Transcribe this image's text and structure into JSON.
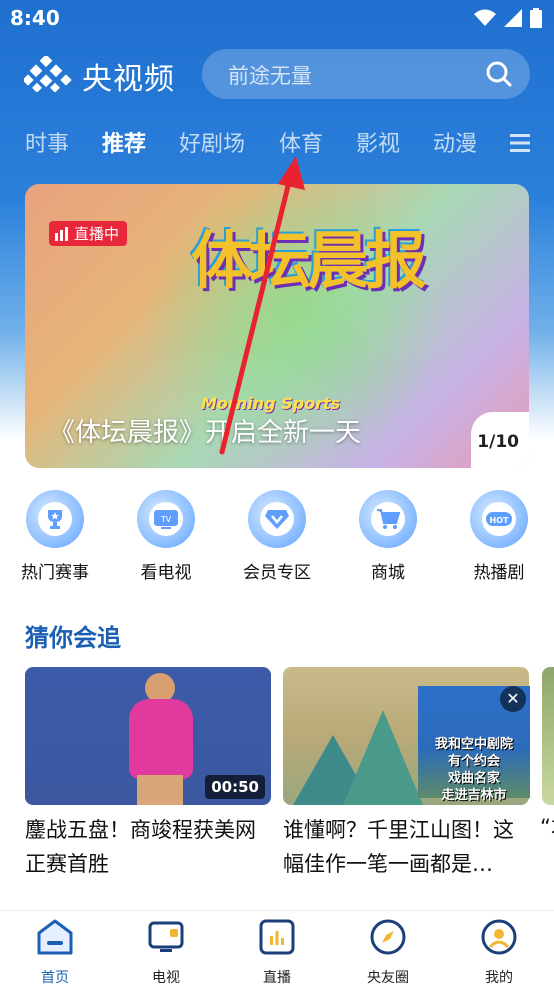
{
  "status_bar": {
    "time": "8:40"
  },
  "header": {
    "app_name": "央视频",
    "search_placeholder": "前途无量"
  },
  "tabs": [
    {
      "label": "时事"
    },
    {
      "label": "推荐"
    },
    {
      "label": "好剧场"
    },
    {
      "label": "体育"
    },
    {
      "label": "影视"
    },
    {
      "label": "动漫"
    }
  ],
  "banner": {
    "live_badge": "直播中",
    "show_logo_text": "体坛晨报",
    "show_logo_subtitle": "Morning Sports",
    "caption": "《体坛晨报》开启全新一天",
    "pager": "1/10"
  },
  "shortcuts": [
    {
      "label": "热门赛事"
    },
    {
      "label": "看电视",
      "badge": "TV"
    },
    {
      "label": "会员专区"
    },
    {
      "label": "商城"
    },
    {
      "label": "热播剧",
      "badge": "HOT"
    }
  ],
  "section": {
    "title": "猜你会追"
  },
  "cards": [
    {
      "title": "鏖战五盘！商竣程获美网正赛首胜",
      "duration": "00:50"
    },
    {
      "title": "谁懂啊？千里江山图！这幅佳作一笔一画都是…"
    }
  ],
  "ad": {
    "text_line1": "我和空中剧院",
    "text_line2": "有个约会",
    "text_line3": "戏曲名家",
    "text_line4": "走进吉林市"
  },
  "card3": {
    "title": "“才"
  },
  "bottom_nav": [
    {
      "label": "首页"
    },
    {
      "label": "电视"
    },
    {
      "label": "直播"
    },
    {
      "label": "央友圈"
    },
    {
      "label": "我的"
    }
  ],
  "colors": {
    "primary_blue": "#1a5fb4",
    "live_red": "#e8283a",
    "arrow_red": "#e8222e"
  }
}
